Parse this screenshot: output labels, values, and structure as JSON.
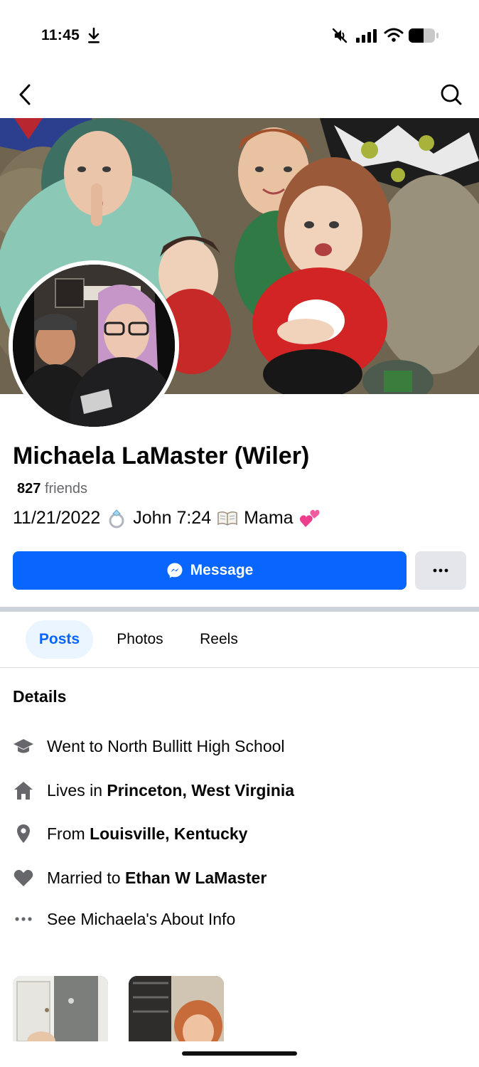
{
  "status_bar": {
    "time": "11:45"
  },
  "profile": {
    "name": "Michaela LaMaster (Wiler)",
    "friends_count": "827",
    "friends_label": "friends",
    "bio_parts": [
      "11/21/2022",
      "John 7:24",
      "Mama"
    ]
  },
  "actions": {
    "message_label": "Message",
    "more_label": "···"
  },
  "tabs": [
    {
      "label": "Posts",
      "active": true
    },
    {
      "label": "Photos",
      "active": false
    },
    {
      "label": "Reels",
      "active": false
    }
  ],
  "details": {
    "title": "Details",
    "items": [
      {
        "icon": "graduation-cap-icon",
        "prefix": "Went to North Bullitt High School",
        "bold": ""
      },
      {
        "icon": "home-icon",
        "prefix": "Lives in ",
        "bold": "Princeton, West Virginia"
      },
      {
        "icon": "location-pin-icon",
        "prefix": "From ",
        "bold": "Louisville, Kentucky"
      },
      {
        "icon": "heart-icon",
        "prefix": "Married to ",
        "bold": "Ethan W LaMaster"
      },
      {
        "icon": "ellipsis-icon",
        "prefix": "See Michaela's About Info",
        "bold": ""
      }
    ]
  },
  "colors": {
    "accent": "#0866ff",
    "secondary_text": "#65676b",
    "icon_gray": "#65676b"
  }
}
